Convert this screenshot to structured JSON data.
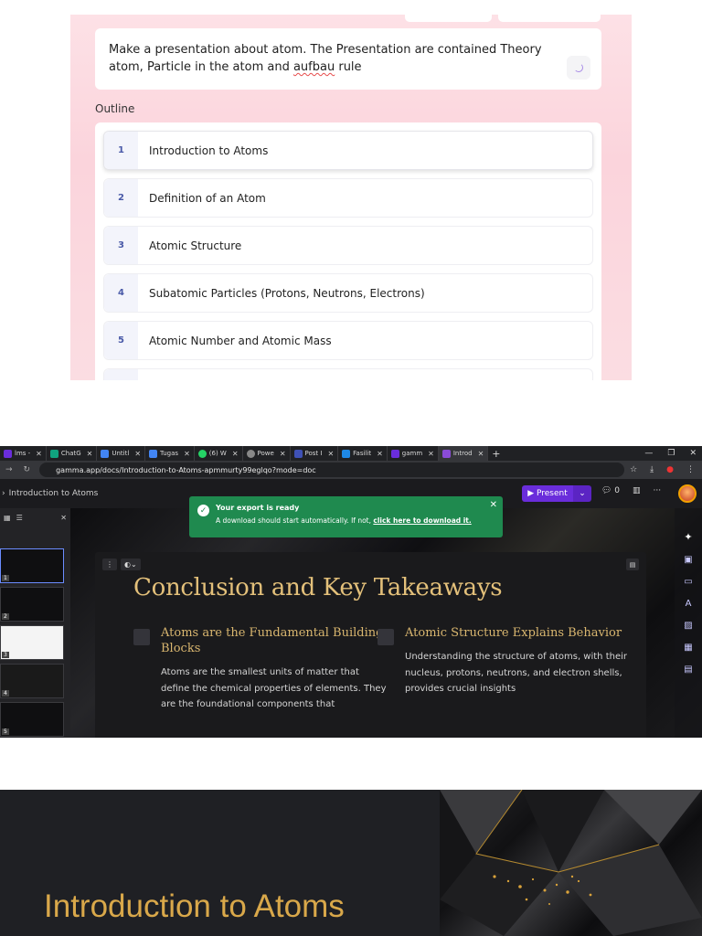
{
  "editor": {
    "prompt": {
      "line1": "Make a presentation about atom. The Presentation are contained Theory",
      "line2_pre": "atom, Particle in the atom and ",
      "line2_err": "aufbau",
      "line2_post": " rule"
    },
    "outline_label": "Outline",
    "outline": [
      {
        "num": "1",
        "label": "Introduction to Atoms"
      },
      {
        "num": "2",
        "label": "Definition of an Atom"
      },
      {
        "num": "3",
        "label": "Atomic Structure"
      },
      {
        "num": "4",
        "label": "Subatomic Particles (Protons, Neutrons, Electrons)"
      },
      {
        "num": "5",
        "label": "Atomic Number and Atomic Mass"
      }
    ]
  },
  "browser": {
    "tabs": [
      {
        "label": "lms -",
        "color": "#6a2ddb"
      },
      {
        "label": "ChatG",
        "color": "#10a37f"
      },
      {
        "label": "Untitl",
        "color": "#4285f4"
      },
      {
        "label": "Tugas",
        "color": "#4285f4"
      },
      {
        "label": "(6) W",
        "color": "#25d366"
      },
      {
        "label": "Powe",
        "color": "#888888"
      },
      {
        "label": "Post I",
        "color": "#3f51b5"
      },
      {
        "label": "Fasilit",
        "color": "#1e88e5"
      },
      {
        "label": "gamm",
        "color": "#6a2ddb"
      },
      {
        "label": "Introd",
        "color": "#8a4bd8"
      }
    ],
    "url": "gamma.app/docs/Introduction-to-Atoms-apmmurty99eglqo?mode=doc",
    "breadcrumb": "Introduction to Atoms",
    "present_label": "Present",
    "comment_count": "0",
    "toast": {
      "title": "Your export is ready",
      "body": "A download should start automatically. If not, ",
      "link": "click here to download it."
    },
    "thumb_numbers": [
      "1",
      "2",
      "3",
      "4",
      "5"
    ],
    "slide": {
      "title": "Conclusion and Key Takeaways",
      "col1_heading": "Atoms are the Fundamental Building Blocks",
      "col1_text": "Atoms are the smallest units of matter that define the chemical properties of elements. They are the foundational components that",
      "col2_heading": "Atomic Structure Explains Behavior",
      "col2_text": "Understanding the structure of atoms, with their nucleus, protons, neutrons, and electron shells, provides crucial insights"
    }
  },
  "slide_preview": {
    "title": "Introduction to Atoms"
  }
}
